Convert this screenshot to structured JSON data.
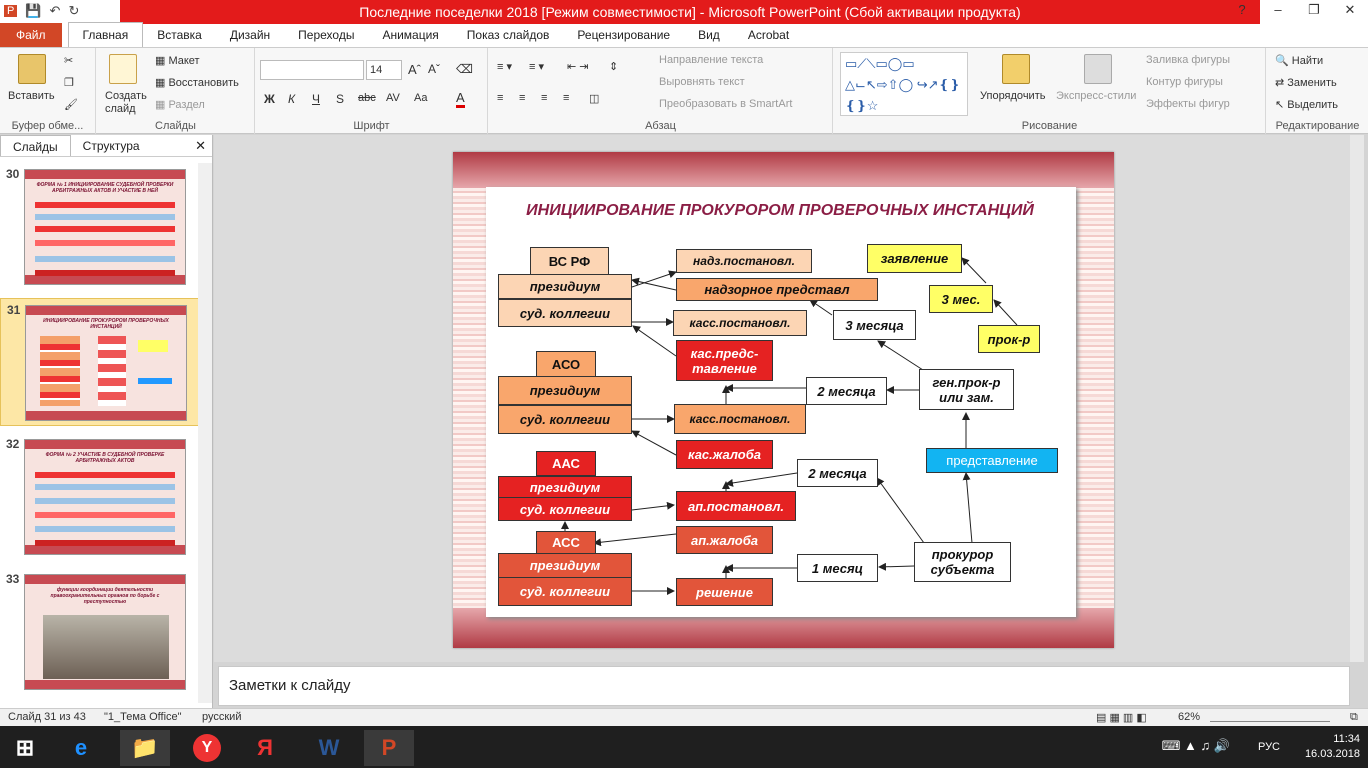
{
  "window": {
    "title": "Последние поседелки 2018 [Режим совместимости] - Microsoft PowerPoint (Сбой активации продукта)"
  },
  "tabs": [
    "Файл",
    "Главная",
    "Вставка",
    "Дизайн",
    "Переходы",
    "Анимация",
    "Показ слайдов",
    "Рецензирование",
    "Вид",
    "Acrobat"
  ],
  "ribbon": {
    "clipboard": {
      "paste": "Вставить",
      "label": "Буфер обме..."
    },
    "slides": {
      "new_slide": "Создать слайд",
      "layout": "Макет",
      "reset": "Восстановить",
      "section": "Раздел",
      "label": "Слайды"
    },
    "font": {
      "size": "14",
      "label": "Шрифт",
      "bold": "Ж",
      "italic": "К",
      "underline": "Ч",
      "shadow": "S",
      "strike": "abc",
      "spacing": "AV",
      "case": "Aa",
      "color": "A"
    },
    "paragraph": {
      "direction": "Направление текста",
      "align": "Выровнять текст",
      "smartart": "Преобразовать в SmartArt",
      "label": "Абзац"
    },
    "drawing": {
      "arrange": "Упорядочить",
      "quickstyles": "Экспресс-стили",
      "fill": "Заливка фигуры",
      "outline": "Контур фигуры",
      "effects": "Эффекты фигур",
      "label": "Рисование"
    },
    "editing": {
      "find": "Найти",
      "replace": "Заменить",
      "select": "Выделить",
      "label": "Редактирование"
    }
  },
  "left_panel": {
    "tab_slides": "Слайды",
    "tab_outline": "Структура",
    "thumbs": [
      {
        "num": "30",
        "title": "ФОРМА № 1 ИНИЦИИРОВАНИЕ СУДЕБНОЙ ПРОВЕРКИ АРБИТРАЖНЫХ АКТОВ И УЧАСТИЕ В НЕЙ"
      },
      {
        "num": "31",
        "title": "ИНИЦИИРОВАНИЕ ПРОКУРОРОМ ПРОВЕРОЧНЫХ ИНСТАНЦИЙ"
      },
      {
        "num": "32",
        "title": "ФОРМА № 2 УЧАСТИЕ В СУДЕБНОЙ ПРОВЕРКЕ АРБИТРАЖНЫХ АКТОВ"
      },
      {
        "num": "33",
        "title": "функции координации деятельности правоохранительных органов по борьбе с преступностью"
      }
    ]
  },
  "slide": {
    "title": "ИНИЦИИРОВАНИЕ ПРОКУРОРОМ ПРОВЕРОЧНЫХ ИНСТАНЦИЙ",
    "boxes": {
      "vs_rf": "ВС РФ",
      "presidium1": "президиум",
      "sud1": "суд. коллегии",
      "aso": "АСО",
      "presidium2": "президиум",
      "sud2": "суд. коллегии",
      "aas": "ААС",
      "presidium3": "президиум",
      "sud3": "суд. коллегии",
      "ass": "АСС",
      "presidium4": "президиум",
      "sud4": "суд. коллегии",
      "nadz_post": "надз.постановл.",
      "nadz_pred": "надзорное представл",
      "kass_post1": "касс.постановл.",
      "kas_pred": "кас.предс-тавление",
      "kass_post2": "касс.постановл.",
      "kas_zhal": "кас.жалоба",
      "ap_post": "ап.постановл.",
      "ap_zhal": "ап.жалоба",
      "reshenie": "решение",
      "zayavlenie": "заявление",
      "tri_mes": "3 мес.",
      "prok_r": "прок-р",
      "tri_mesyatsa": "3 месяца",
      "dva_mes1": "2 месяца",
      "gen_prok": "ген.прок-р или зам.",
      "predstavlenie": "представление",
      "dva_mes2": "2 месяца",
      "odin_mes": "1 месяц",
      "prok_subj": "прокурор субъекта"
    }
  },
  "notes_placeholder": "Заметки к слайду",
  "status": {
    "slide": "Слайд 31 из 43",
    "theme": "\"1_Тема Office\"",
    "lang": "русский",
    "zoom": "62%"
  },
  "taskbar": {
    "lang": "РУС",
    "time": "11:34",
    "date": "16.03.2018"
  },
  "colors": {
    "accent": "#d24726",
    "title_red": "#e31b1b",
    "slide_title": "#8b1e45"
  }
}
